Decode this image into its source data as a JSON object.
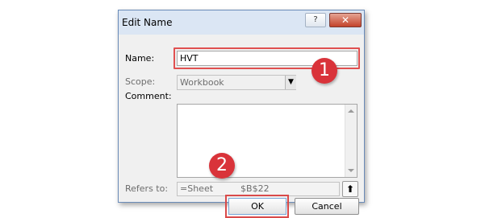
{
  "dialog": {
    "title": "Edit Name",
    "help_glyph": "?",
    "close_glyph": "✕",
    "labels": {
      "name": "Name:",
      "scope": "Scope:",
      "comment": "Comment:",
      "refers_to": "Refers to:"
    },
    "name_value": "HVT",
    "scope_value": "Workbook",
    "refers_to_value": "=Sheet",
    "refers_to_tail": "$B$22",
    "ok_label": "OK",
    "cancel_label": "Cancel"
  },
  "annotations": {
    "marker_1": "1",
    "marker_2": "2",
    "highlight_color": "#e05050",
    "marker_color": "#d9333a"
  }
}
